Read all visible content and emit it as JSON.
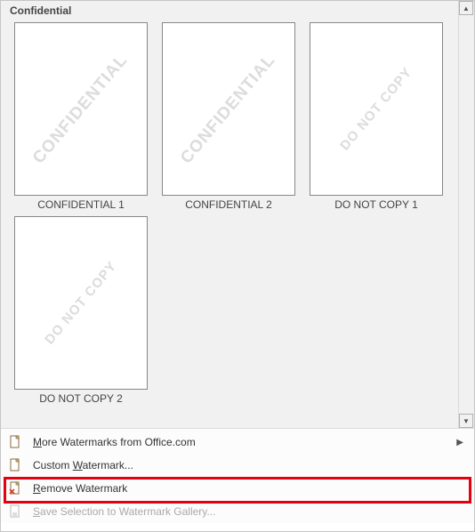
{
  "section": {
    "title": "Confidential"
  },
  "thumbs": [
    {
      "watermark": "CONFIDENTIAL",
      "size": "lg",
      "label": "CONFIDENTIAL 1"
    },
    {
      "watermark": "CONFIDENTIAL",
      "size": "lg",
      "label": "CONFIDENTIAL 2"
    },
    {
      "watermark": "DO NOT COPY",
      "size": "sm",
      "label": "DO NOT COPY 1"
    },
    {
      "watermark": "DO NOT COPY",
      "size": "sm",
      "label": "DO NOT COPY 2"
    }
  ],
  "menu": {
    "more": {
      "pre": "",
      "mn": "M",
      "post": "ore Watermarks from Office.com"
    },
    "custom": {
      "pre": "Custom ",
      "mn": "W",
      "post": "atermark..."
    },
    "remove": {
      "pre": "",
      "mn": "R",
      "post": "emove Watermark"
    },
    "save": {
      "pre": "",
      "mn": "S",
      "post": "ave Selection to Watermark Gallery..."
    }
  }
}
